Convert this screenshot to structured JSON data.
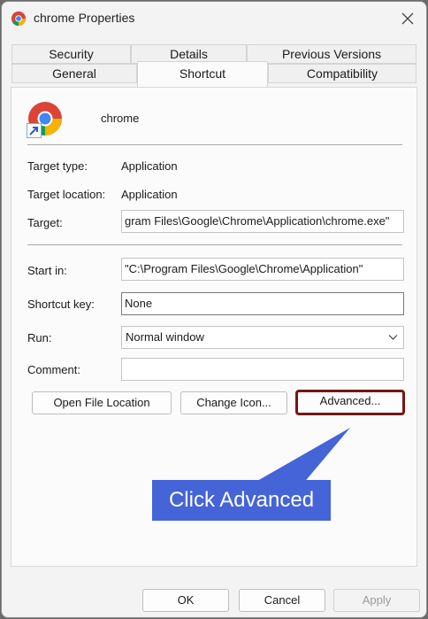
{
  "window": {
    "title": "chrome Properties"
  },
  "tabs": {
    "row_back": [
      {
        "label": "Security"
      },
      {
        "label": "Details"
      },
      {
        "label": "Previous Versions"
      }
    ],
    "row_front": [
      {
        "label": "General"
      },
      {
        "label": "Shortcut"
      },
      {
        "label": "Compatibility"
      }
    ],
    "active": "Shortcut"
  },
  "shortcut": {
    "name": "chrome",
    "target_type_label": "Target type:",
    "target_type_value": "Application",
    "target_location_label": "Target location:",
    "target_location_value": "Application",
    "target_label": "Target:",
    "target_value": "gram Files\\Google\\Chrome\\Application\\chrome.exe\"",
    "start_in_label": "Start in:",
    "start_in_value": "\"C:\\Program Files\\Google\\Chrome\\Application\"",
    "shortcut_key_label": "Shortcut key:",
    "shortcut_key_value": "None",
    "run_label": "Run:",
    "run_value": "Normal window",
    "comment_label": "Comment:",
    "comment_value": ""
  },
  "buttons": {
    "open_file_location": "Open File Location",
    "change_icon": "Change Icon...",
    "advanced": "Advanced...",
    "ok": "OK",
    "cancel": "Cancel",
    "apply": "Apply"
  },
  "annotation": {
    "text": "Click Advanced",
    "color": "#4464d8",
    "highlight_color": "#741616"
  },
  "icons": [
    "chrome-logo-icon",
    "shortcut-arrow-icon",
    "close-icon",
    "chevron-down-icon"
  ]
}
